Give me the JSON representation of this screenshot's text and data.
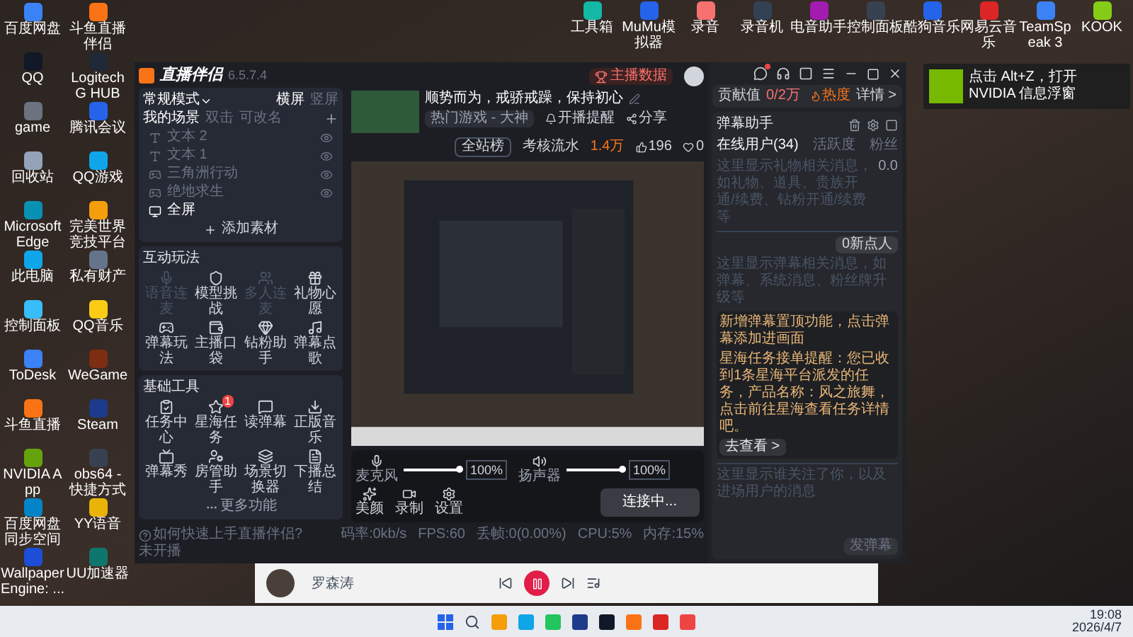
{
  "desktop": {
    "left_icons": [
      "百度网盘",
      "斗鱼直播伴侣",
      "QQ",
      "Logitech G HUB",
      "game",
      "腾讯会议",
      "回收站",
      "QQ游戏",
      "Microsoft Edge",
      "完美世界竞技平台",
      "此电脑",
      "私有财产",
      "控制面板",
      "QQ音乐",
      "ToDesk",
      "WeGame",
      "斗鱼直播",
      "Steam",
      "NVIDIA App",
      "obs64 - 快捷方式",
      "百度网盘同步空间",
      "YY语音",
      "Wallpaper Engine: ...",
      "UU加速器"
    ],
    "top_icons": [
      "工具箱",
      "MuMu模拟器",
      "录音",
      "录音机",
      "电音助手",
      "控制面板",
      "酷狗音乐",
      "网易云音乐",
      "TeamSpeak 3",
      "KOOK"
    ]
  },
  "notification": {
    "text": "点击 Alt+Z，打开 NVIDIA 信息浮窗"
  },
  "app": {
    "logo": "直播伴侣",
    "version": "6.5.7.4",
    "mode": "常规模式",
    "orientations": [
      {
        "label": "横屏",
        "selected": true
      },
      {
        "label": "竖屏",
        "selected": false
      }
    ],
    "scene_tabs": [
      {
        "label": "我的场景",
        "selected": true
      },
      {
        "label": "双击",
        "selected": false
      },
      {
        "label": "可改名",
        "selected": false
      }
    ],
    "sources": [
      {
        "name": "文本 2",
        "kind": "text",
        "selected": false
      },
      {
        "name": "文本 1",
        "kind": "text",
        "selected": false
      },
      {
        "name": "三角洲行动",
        "kind": "game",
        "selected": false
      },
      {
        "name": "绝地求生",
        "kind": "game",
        "selected": false
      },
      {
        "name": "全屏",
        "kind": "screen",
        "selected": true
      }
    ],
    "add_source": "添加素材",
    "interactive": {
      "title": "互动玩法",
      "items": [
        {
          "label": "语音连麦",
          "disabled": true
        },
        {
          "label": "模型挑战",
          "disabled": false
        },
        {
          "label": "多人连麦",
          "disabled": true
        },
        {
          "label": "礼物心愿",
          "disabled": false
        },
        {
          "label": "弹幕玩法",
          "disabled": false
        },
        {
          "label": "主播口袋",
          "disabled": false
        },
        {
          "label": "钻粉助手",
          "disabled": false
        },
        {
          "label": "弹幕点歌",
          "disabled": false
        }
      ]
    },
    "tools": {
      "title": "基础工具",
      "items": [
        {
          "label": "任务中心"
        },
        {
          "label": "星海任务",
          "badge": "1"
        },
        {
          "label": "读弹幕"
        },
        {
          "label": "正版音乐"
        },
        {
          "label": "弹幕秀"
        },
        {
          "label": "房管助手"
        },
        {
          "label": "场景切换器"
        },
        {
          "label": "下播总结"
        }
      ],
      "more": "更多功能"
    },
    "stream": {
      "data_button": "主播数据",
      "title": "顺势而为，戒骄戒躁，保持初心",
      "category": "热门游戏 - 大神",
      "remind": "开播提醒",
      "share": "分享",
      "rank": "全站榜",
      "revenue_label": "考核流水",
      "revenue": "1.4万",
      "likes": "196",
      "hearts": "0"
    },
    "controls": {
      "mic": {
        "label": "麦克风",
        "level": 1,
        "reading": "100%"
      },
      "speaker": {
        "label": "扬声器",
        "level": 1,
        "reading": "100%"
      },
      "tools": [
        "美颜",
        "录制",
        "设置"
      ],
      "connect": "连接中..."
    },
    "status": {
      "help": "如何快速上手直播伴侣?",
      "stats": [
        "码率:0kb/s",
        "FPS:60",
        "丢帧:0(0.00%)",
        "CPU:5%",
        "内存:15%",
        "未开播"
      ]
    },
    "contribution": {
      "label": "贡献值",
      "value": "0/2万",
      "heat": "热度",
      "details": "详情 >"
    },
    "danmaku": {
      "title": "弹幕助手",
      "tabs": [
        {
          "label": "在线用户(34)",
          "selected": true
        },
        {
          "label": "活跃度",
          "selected": false
        },
        {
          "label": "粉丝",
          "selected": false
        }
      ],
      "gift_hint": "这里显示礼物相关消息，如礼物、道具、贵族开通/续费、钻粉开通/续费等",
      "gift_value": "0.0",
      "chat_hint": "这里显示弹幕相关消息，如弹幕、系统消息、粉丝牌升级等",
      "chat_badge": "0新点人",
      "notices": [
        {
          "text": "新增弹幕置顶功能，点击弹幕添加进画面"
        },
        {
          "text": "星海任务接单提醒：您已收到1条星海平台派发的任务，产品名称：风之旅舞，点击前往星海查看任务详情吧。",
          "action": "去查看 >"
        }
      ],
      "follow_hint": "这里显示谁关注了你，以及进场用户的消息",
      "send": "发弹幕"
    }
  },
  "music": {
    "artist": "罗森涛"
  },
  "taskbar": {
    "time": "19:08",
    "date": "2026/4/7"
  }
}
